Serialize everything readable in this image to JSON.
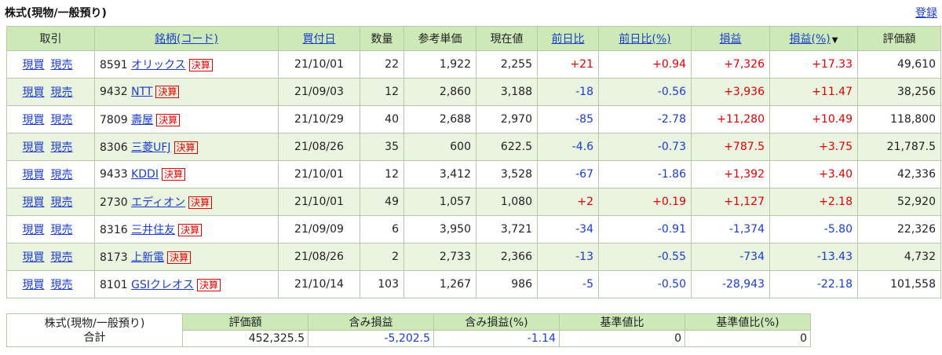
{
  "header": {
    "title": "株式(現物/一般預り)",
    "register_link": "登録"
  },
  "table": {
    "columns": {
      "trade": "取引",
      "name": "銘柄(コード)",
      "buy_date": "買付日",
      "qty": "数量",
      "ref_price": "参考単価",
      "cur_price": "現在値",
      "day_change": "前日比",
      "day_change_pct": "前日比(%)",
      "pl": "損益",
      "pl_pct": "損益(%)",
      "value": "評価額"
    },
    "buy_label": "現買",
    "sell_label": "現売",
    "badge_label": "決算",
    "rows": [
      {
        "code": "8591",
        "name": "オリックス",
        "date": "21/10/01",
        "qty": "22",
        "ref": "1,922",
        "cur": "2,255",
        "chg": "+21",
        "chgp": "+0.94",
        "pl": "+7,326",
        "plp": "+17.33",
        "val": "49,610",
        "chg_sign": "pos",
        "pl_sign": "pos"
      },
      {
        "code": "9432",
        "name": "NTT",
        "date": "21/09/03",
        "qty": "12",
        "ref": "2,860",
        "cur": "3,188",
        "chg": "-18",
        "chgp": "-0.56",
        "pl": "+3,936",
        "plp": "+11.47",
        "val": "38,256",
        "chg_sign": "neg",
        "pl_sign": "pos"
      },
      {
        "code": "7809",
        "name": "壽屋",
        "date": "21/10/29",
        "qty": "40",
        "ref": "2,688",
        "cur": "2,970",
        "chg": "-85",
        "chgp": "-2.78",
        "pl": "+11,280",
        "plp": "+10.49",
        "val": "118,800",
        "chg_sign": "neg",
        "pl_sign": "pos"
      },
      {
        "code": "8306",
        "name": "三菱UFJ",
        "date": "21/08/26",
        "qty": "35",
        "ref": "600",
        "cur": "622.5",
        "chg": "-4.6",
        "chgp": "-0.73",
        "pl": "+787.5",
        "plp": "+3.75",
        "val": "21,787.5",
        "chg_sign": "neg",
        "pl_sign": "pos"
      },
      {
        "code": "9433",
        "name": "KDDI",
        "date": "21/10/01",
        "qty": "12",
        "ref": "3,412",
        "cur": "3,528",
        "chg": "-67",
        "chgp": "-1.86",
        "pl": "+1,392",
        "plp": "+3.40",
        "val": "42,336",
        "chg_sign": "neg",
        "pl_sign": "pos"
      },
      {
        "code": "2730",
        "name": "エディオン",
        "date": "21/10/01",
        "qty": "49",
        "ref": "1,057",
        "cur": "1,080",
        "chg": "+2",
        "chgp": "+0.19",
        "pl": "+1,127",
        "plp": "+2.18",
        "val": "52,920",
        "chg_sign": "pos",
        "pl_sign": "pos"
      },
      {
        "code": "8316",
        "name": "三井住友",
        "date": "21/09/09",
        "qty": "6",
        "ref": "3,950",
        "cur": "3,721",
        "chg": "-34",
        "chgp": "-0.91",
        "pl": "-1,374",
        "plp": "-5.80",
        "val": "22,326",
        "chg_sign": "neg",
        "pl_sign": "neg"
      },
      {
        "code": "8173",
        "name": "上新電",
        "date": "21/08/26",
        "qty": "2",
        "ref": "2,733",
        "cur": "2,366",
        "chg": "-13",
        "chgp": "-0.55",
        "pl": "-734",
        "plp": "-13.43",
        "val": "4,732",
        "chg_sign": "neg",
        "pl_sign": "neg"
      },
      {
        "code": "8101",
        "name": "GSIクレオス",
        "date": "21/10/14",
        "qty": "103",
        "ref": "1,267",
        "cur": "986",
        "chg": "-5",
        "chgp": "-0.50",
        "pl": "-28,943",
        "plp": "-22.18",
        "val": "101,558",
        "chg_sign": "neg",
        "pl_sign": "neg"
      }
    ]
  },
  "summary": {
    "label_line1": "株式(現物/一般預り)",
    "label_line2": "合計",
    "headers": [
      "評価額",
      "含み損益",
      "含み損益(%)",
      "基準値比",
      "基準値比(%)"
    ],
    "values": [
      "452,325.5",
      "-5,202.5",
      "-1.14",
      "0",
      "0"
    ],
    "value_signs": [
      "",
      "neg",
      "neg",
      "",
      ""
    ]
  },
  "colors": {
    "header_bg": "#cde9b8",
    "alt_row_bg": "#eaf4e0",
    "positive": "#e00000",
    "negative": "#1a3dcc",
    "link": "#1a3dcc"
  },
  "icons": {
    "sort": "sort-descending-icon"
  }
}
